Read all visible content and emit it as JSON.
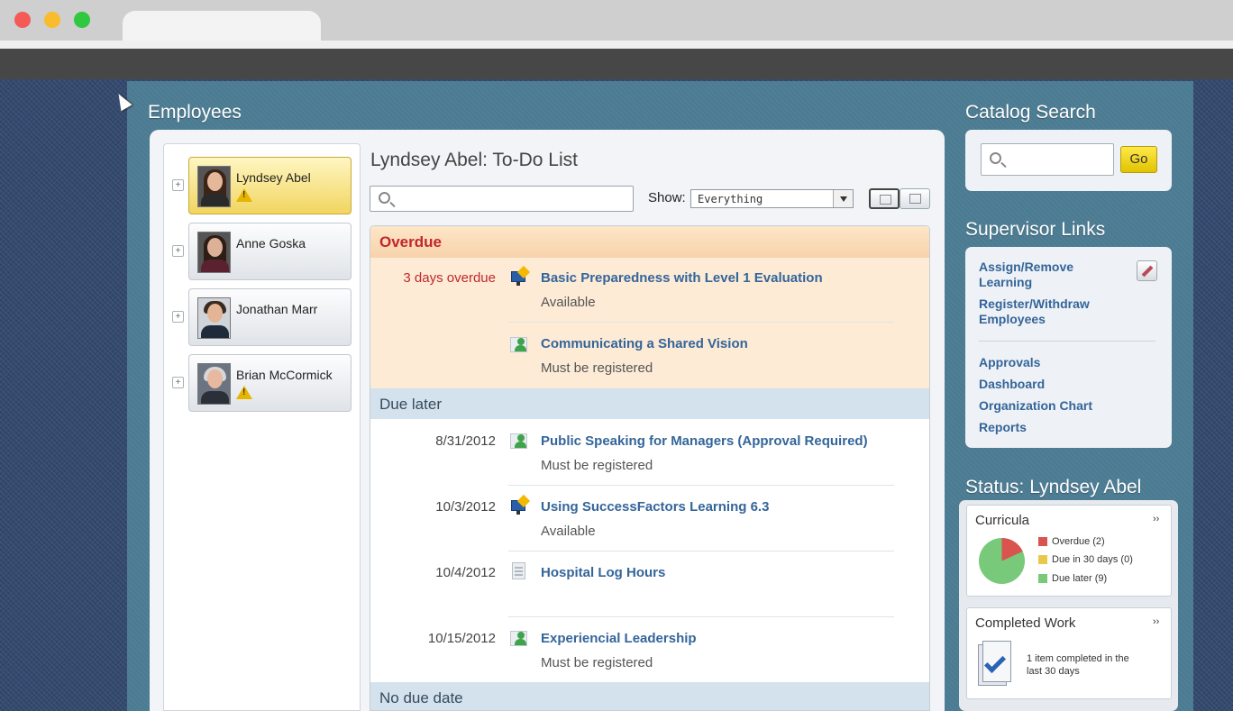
{
  "employees": {
    "title": "Employees",
    "list": [
      {
        "name": "Lyndsey Abel",
        "warning": true,
        "selected": true
      },
      {
        "name": "Anne Goska",
        "warning": false,
        "selected": false
      },
      {
        "name": "Jonathan Marr",
        "warning": false,
        "selected": false
      },
      {
        "name": "Brian McCormick",
        "warning": true,
        "selected": false
      }
    ]
  },
  "todo": {
    "title": "Lyndsey Abel: To-Do List",
    "search_placeholder": "",
    "show_label": "Show:",
    "show_value": "Everything",
    "groups": [
      {
        "label": "Overdue",
        "items": [
          {
            "date": "3 days overdue",
            "icon": "course-icon",
            "title": "Basic Preparedness with Level 1 Evaluation",
            "status": "Available"
          },
          {
            "date": "",
            "icon": "instructor-led-icon",
            "title": "Communicating a Shared Vision",
            "status": "Must be registered"
          }
        ]
      },
      {
        "label": "Due later",
        "items": [
          {
            "date": "8/31/2012",
            "icon": "instructor-led-icon",
            "title": "Public Speaking for Managers (Approval Required)",
            "status": "Must be registered"
          },
          {
            "date": "10/3/2012",
            "icon": "course-icon",
            "title": "Using SuccessFactors Learning 6.3",
            "status": "Available"
          },
          {
            "date": "10/4/2012",
            "icon": "document-icon",
            "title": "Hospital Log Hours",
            "status": ""
          },
          {
            "date": "10/15/2012",
            "icon": "instructor-led-icon",
            "title": "Experiencial Leadership",
            "status": "Must be registered"
          }
        ]
      },
      {
        "label": "No due date",
        "items": []
      }
    ]
  },
  "catalog": {
    "title": "Catalog Search",
    "go_label": "Go",
    "placeholder": ""
  },
  "supervisor": {
    "title": "Supervisor Links",
    "links_top": [
      "Assign/Remove Learning",
      "Register/Withdraw Employees"
    ],
    "links_bottom": [
      "Approvals",
      "Dashboard",
      "Organization Chart",
      "Reports"
    ]
  },
  "status": {
    "title": "Status: Lyndsey Abel",
    "curricula": {
      "title": "Curricula",
      "more": "››",
      "legend": [
        {
          "label": "Overdue (2)",
          "color": "#d9534f"
        },
        {
          "label": "Due in 30 days (0)",
          "color": "#e8c84a"
        },
        {
          "label": "Due later (9)",
          "color": "#78c97a"
        }
      ],
      "pie_values": {
        "overdue": 2,
        "due_30": 0,
        "due_later": 9
      }
    },
    "completed": {
      "title": "Completed Work",
      "more": "››",
      "text": "1 item completed in the last 30 days"
    }
  },
  "colors": {
    "accent_link": "#34659a",
    "overdue_red": "#c0272d",
    "go_button": "#f2d51a"
  }
}
